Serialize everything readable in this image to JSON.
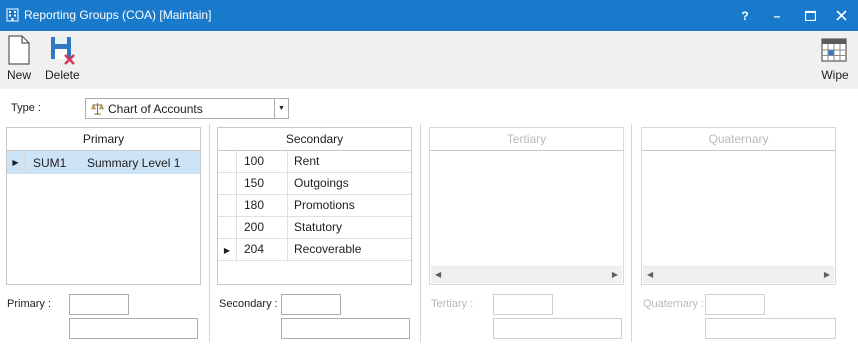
{
  "window": {
    "title": "Reporting Groups (COA) [Maintain]",
    "help": "?",
    "minimize": "–",
    "maximize": "▢",
    "close": "✕"
  },
  "toolbar": {
    "new_label": "New",
    "delete_label": "Delete",
    "wipe_label": "Wipe"
  },
  "type": {
    "label": "Type :",
    "value": "Chart of Accounts"
  },
  "grids": {
    "primary": {
      "header": "Primary",
      "rows": [
        {
          "code": "SUM1",
          "name": "Summary Level 1"
        }
      ]
    },
    "secondary": {
      "header": "Secondary",
      "rows": [
        {
          "code": "100",
          "name": "Rent"
        },
        {
          "code": "150",
          "name": "Outgoings"
        },
        {
          "code": "180",
          "name": "Promotions"
        },
        {
          "code": "200",
          "name": "Statutory"
        },
        {
          "code": "204",
          "name": "Recoverable"
        }
      ]
    },
    "tertiary": {
      "header": "Tertiary"
    },
    "quaternary": {
      "header": "Quaternary"
    }
  },
  "fields": {
    "primary_label": "Primary :",
    "secondary_label": "Secondary :",
    "tertiary_label": "Tertiary :",
    "quaternary_label": "Quaternary :"
  },
  "colors": {
    "titlebar": "#1979ca",
    "selected_row": "#cde4f7",
    "delete_x": "#d9345a"
  }
}
